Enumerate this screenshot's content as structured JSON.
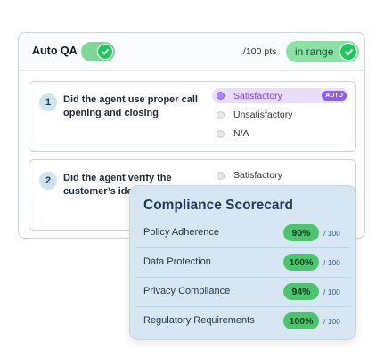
{
  "qa": {
    "title": "Auto QA",
    "points": "/100 pts",
    "range_label": "in range"
  },
  "questions": [
    {
      "number": "1",
      "text": "Did the agent use proper call opening and closing",
      "options": [
        {
          "label": "Satisfactory",
          "selected": true,
          "badge": "AUTO"
        },
        {
          "label": "Unsatisfactory",
          "selected": false
        },
        {
          "label": "N/A",
          "selected": false
        }
      ]
    },
    {
      "number": "2",
      "text": "Did the agent verify the customer’s ide",
      "options": [
        {
          "label": "Satisfactory",
          "selected": false
        }
      ]
    }
  ],
  "scorecard": {
    "title": "Compliance Scorecard",
    "rows": [
      {
        "label": "Policy Adherence",
        "score": "90%",
        "max": "/ 100"
      },
      {
        "label": "Data Protection",
        "score": "100%",
        "max": "/ 100"
      },
      {
        "label": "Privacy Compliance",
        "score": "94%",
        "max": "/ 100"
      },
      {
        "label": "Regulatory Requirements",
        "score": "100%",
        "max": "/ 100"
      }
    ]
  },
  "colors": {
    "accent_green": "#22c55e",
    "accent_purple": "#8b5cf6",
    "scorecard_bg": "#d7e6f3"
  }
}
